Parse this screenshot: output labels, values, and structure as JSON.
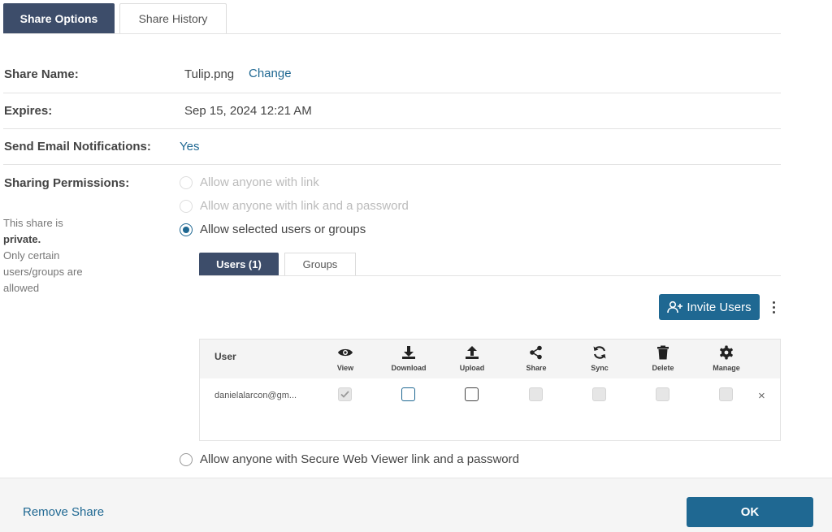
{
  "tabs": {
    "active": "Share Options",
    "inactive": "Share History"
  },
  "share_name": {
    "label": "Share Name:",
    "value": "Tulip.png",
    "change_link": "Change"
  },
  "expires": {
    "label": "Expires:",
    "value": "Sep 15, 2024 12:21 AM"
  },
  "email_notifications": {
    "label": "Send Email Notifications:",
    "value": "Yes"
  },
  "permissions": {
    "label": "Sharing Permissions:",
    "desc_line1": "This share is",
    "desc_bold": "private.",
    "desc_line3": "Only certain",
    "desc_line4": "users/groups are",
    "desc_line5": "allowed",
    "options": [
      {
        "text": "Allow anyone with link",
        "state": "disabled"
      },
      {
        "text": "Allow anyone with link and a password",
        "state": "disabled"
      },
      {
        "text": "Allow selected users or groups",
        "state": "checked"
      },
      {
        "text": "Allow anyone with Secure Web Viewer link and a password",
        "state": "unchecked"
      }
    ]
  },
  "inner_tabs": {
    "users": "Users (1)",
    "groups": "Groups"
  },
  "invite_button": "Invite Users",
  "table": {
    "user_header": "User",
    "columns": [
      "View",
      "Download",
      "Upload",
      "Share",
      "Sync",
      "Delete",
      "Manage"
    ],
    "rows": [
      {
        "user": "danielalarcon@gm...",
        "view": "checked-disabled",
        "download": "unchecked",
        "upload": "unchecked",
        "share": "disabled",
        "sync": "disabled",
        "delete": "disabled",
        "manage": "disabled",
        "remove": "×"
      }
    ]
  },
  "footer": {
    "remove_share": "Remove Share",
    "ok": "OK"
  },
  "colors": {
    "accent": "#1f6892",
    "tab_active": "#3d4d6a"
  }
}
